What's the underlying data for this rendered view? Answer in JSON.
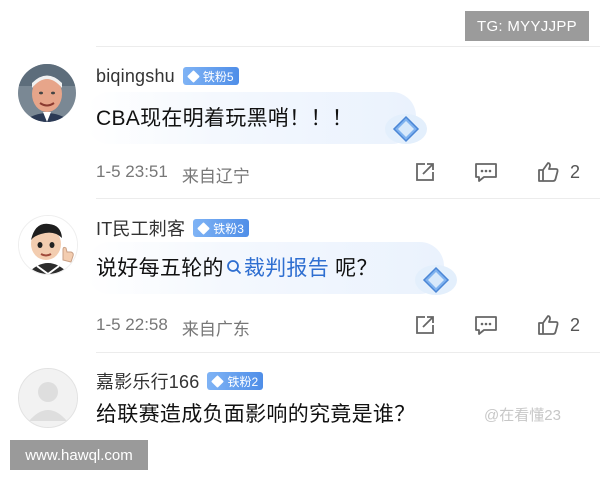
{
  "watermarks": {
    "top_right": "TG: MYYJJPP",
    "bottom_left": "www.hawql.com",
    "corner": "@在看懂23"
  },
  "comments": [
    {
      "username": "biqingshu",
      "badge": "铁粉5",
      "text": "CBA现在明着玩黑哨！！！",
      "time": "1-5 23:51",
      "location": "来自辽宁",
      "likes": "2",
      "avatar_icon": "avatar-elderly-man-photo"
    },
    {
      "username": "IT民工刺客",
      "badge": "铁粉3",
      "text_before": "说好每五轮的",
      "search_term": "裁判报告",
      "text_after": " 呢？",
      "time": "1-5 22:58",
      "location": "来自广东",
      "likes": "2",
      "avatar_icon": "avatar-cartoon-thumbs-up"
    },
    {
      "username": "嘉影乐行166",
      "badge": "铁粉2",
      "text": "给联赛造成负面影响的究竟是谁？",
      "avatar_icon": "avatar-default-gray"
    }
  ],
  "icons": {
    "share": "share-icon",
    "comment": "comment-icon",
    "like": "thumbs-up-icon",
    "search": "search-icon",
    "gem": "diamond-gem-icon"
  },
  "colors": {
    "link": "#2f6fd1",
    "badge": "#5b97ea",
    "meta": "#777777"
  }
}
